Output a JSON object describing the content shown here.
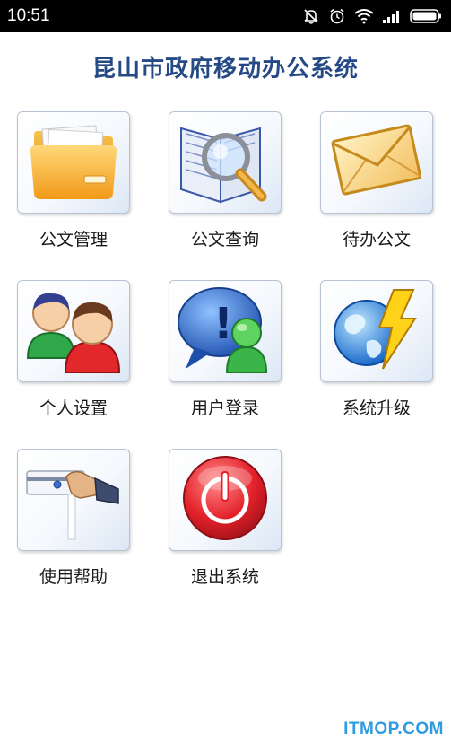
{
  "status_bar": {
    "time": "10:51",
    "icons": [
      "mute-icon",
      "alarm-icon",
      "wifi-icon",
      "signal-icon",
      "battery-icon"
    ]
  },
  "app": {
    "title": "昆山市政府移动办公系统"
  },
  "menu": [
    {
      "label": "公文管理",
      "icon": "folder-icon"
    },
    {
      "label": "公文查询",
      "icon": "magnifier-book-icon"
    },
    {
      "label": "待办公文",
      "icon": "envelope-icon"
    },
    {
      "label": "个人设置",
      "icon": "users-icon"
    },
    {
      "label": "用户登录",
      "icon": "user-chat-icon"
    },
    {
      "label": "系统升级",
      "icon": "globe-lightning-icon"
    },
    {
      "label": "使用帮助",
      "icon": "hand-card-icon"
    },
    {
      "label": "退出系统",
      "icon": "power-icon"
    }
  ],
  "watermark": "ITMOP.COM"
}
